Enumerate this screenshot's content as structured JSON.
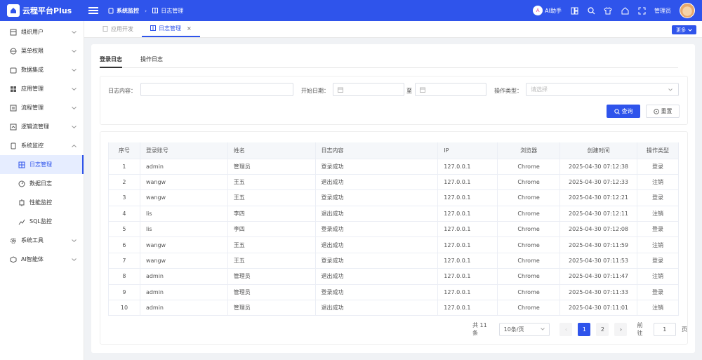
{
  "header": {
    "app_name": "云程平台Plus",
    "breadcrumb": [
      "系统监控",
      "日志管理"
    ],
    "ai_label": "AI助手",
    "ai_badge": "A",
    "user": "管理员"
  },
  "sidebar": {
    "items": [
      {
        "label": "组织用户",
        "icon": "org-icon",
        "chevron": "down"
      },
      {
        "label": "菜单权限",
        "icon": "globe-icon",
        "chevron": "down"
      },
      {
        "label": "数据集成",
        "icon": "box-icon",
        "chevron": "down"
      },
      {
        "label": "应用管理",
        "icon": "apps-icon",
        "chevron": "down"
      },
      {
        "label": "流程管理",
        "icon": "flow-icon",
        "chevron": "down"
      },
      {
        "label": "逻辑流管理",
        "icon": "logic-icon",
        "chevron": "down"
      },
      {
        "label": "系统监控",
        "icon": "monitor-icon",
        "chevron": "up"
      },
      {
        "label": "日志管理",
        "icon": "grid-icon",
        "sub": true,
        "active": true
      },
      {
        "label": "数据日志",
        "icon": "gauge-icon",
        "sub": true
      },
      {
        "label": "性能监控",
        "icon": "chip-icon",
        "sub": true
      },
      {
        "label": "SQL监控",
        "icon": "chart-icon",
        "sub": true
      },
      {
        "label": "系统工具",
        "icon": "gear-icon",
        "chevron": "down"
      },
      {
        "label": "AI智能体",
        "icon": "cube-icon",
        "chevron": "down"
      }
    ]
  },
  "tabs": [
    {
      "label": "应用开发",
      "active": false
    },
    {
      "label": "日志管理",
      "active": true,
      "close": "×"
    }
  ],
  "more_label": "更多",
  "inner_tabs": [
    "登录日志",
    "操作日志"
  ],
  "filter": {
    "content_label": "日志内容：",
    "start_label": "开始日期：",
    "to_label": "至",
    "type_label": "操作类型：",
    "type_placeholder": "请选择",
    "query_label": "查询",
    "reset_label": "重置"
  },
  "table": {
    "columns": [
      "序号",
      "登录账号",
      "姓名",
      "日志内容",
      "IP",
      "浏览器",
      "创建时间",
      "操作类型"
    ],
    "rows": [
      [
        "1",
        "admin",
        "管理员",
        "登录成功",
        "127.0.0.1",
        "Chrome",
        "2025-04-30 07:12:38",
        "登录"
      ],
      [
        "2",
        "wangw",
        "王五",
        "退出成功",
        "127.0.0.1",
        "Chrome",
        "2025-04-30 07:12:33",
        "注销"
      ],
      [
        "3",
        "wangw",
        "王五",
        "登录成功",
        "127.0.0.1",
        "Chrome",
        "2025-04-30 07:12:21",
        "登录"
      ],
      [
        "4",
        "lis",
        "李四",
        "退出成功",
        "127.0.0.1",
        "Chrome",
        "2025-04-30 07:12:11",
        "注销"
      ],
      [
        "5",
        "lis",
        "李四",
        "登录成功",
        "127.0.0.1",
        "Chrome",
        "2025-04-30 07:12:08",
        "登录"
      ],
      [
        "6",
        "wangw",
        "王五",
        "退出成功",
        "127.0.0.1",
        "Chrome",
        "2025-04-30 07:11:59",
        "注销"
      ],
      [
        "7",
        "wangw",
        "王五",
        "登录成功",
        "127.0.0.1",
        "Chrome",
        "2025-04-30 07:11:53",
        "登录"
      ],
      [
        "8",
        "admin",
        "管理员",
        "退出成功",
        "127.0.0.1",
        "Chrome",
        "2025-04-30 07:11:47",
        "注销"
      ],
      [
        "9",
        "admin",
        "管理员",
        "登录成功",
        "127.0.0.1",
        "Chrome",
        "2025-04-30 07:11:33",
        "登录"
      ],
      [
        "10",
        "admin",
        "管理员",
        "退出成功",
        "127.0.0.1",
        "Chrome",
        "2025-04-30 07:11:01",
        "注销"
      ]
    ]
  },
  "pagination": {
    "total": "共 11 条",
    "page_size": "10条/页",
    "pages": [
      "1",
      "2"
    ],
    "current": "1",
    "goto_label": "前往",
    "goto_value": "1",
    "page_unit": "页"
  },
  "colors": {
    "primary": "#2f54eb"
  }
}
